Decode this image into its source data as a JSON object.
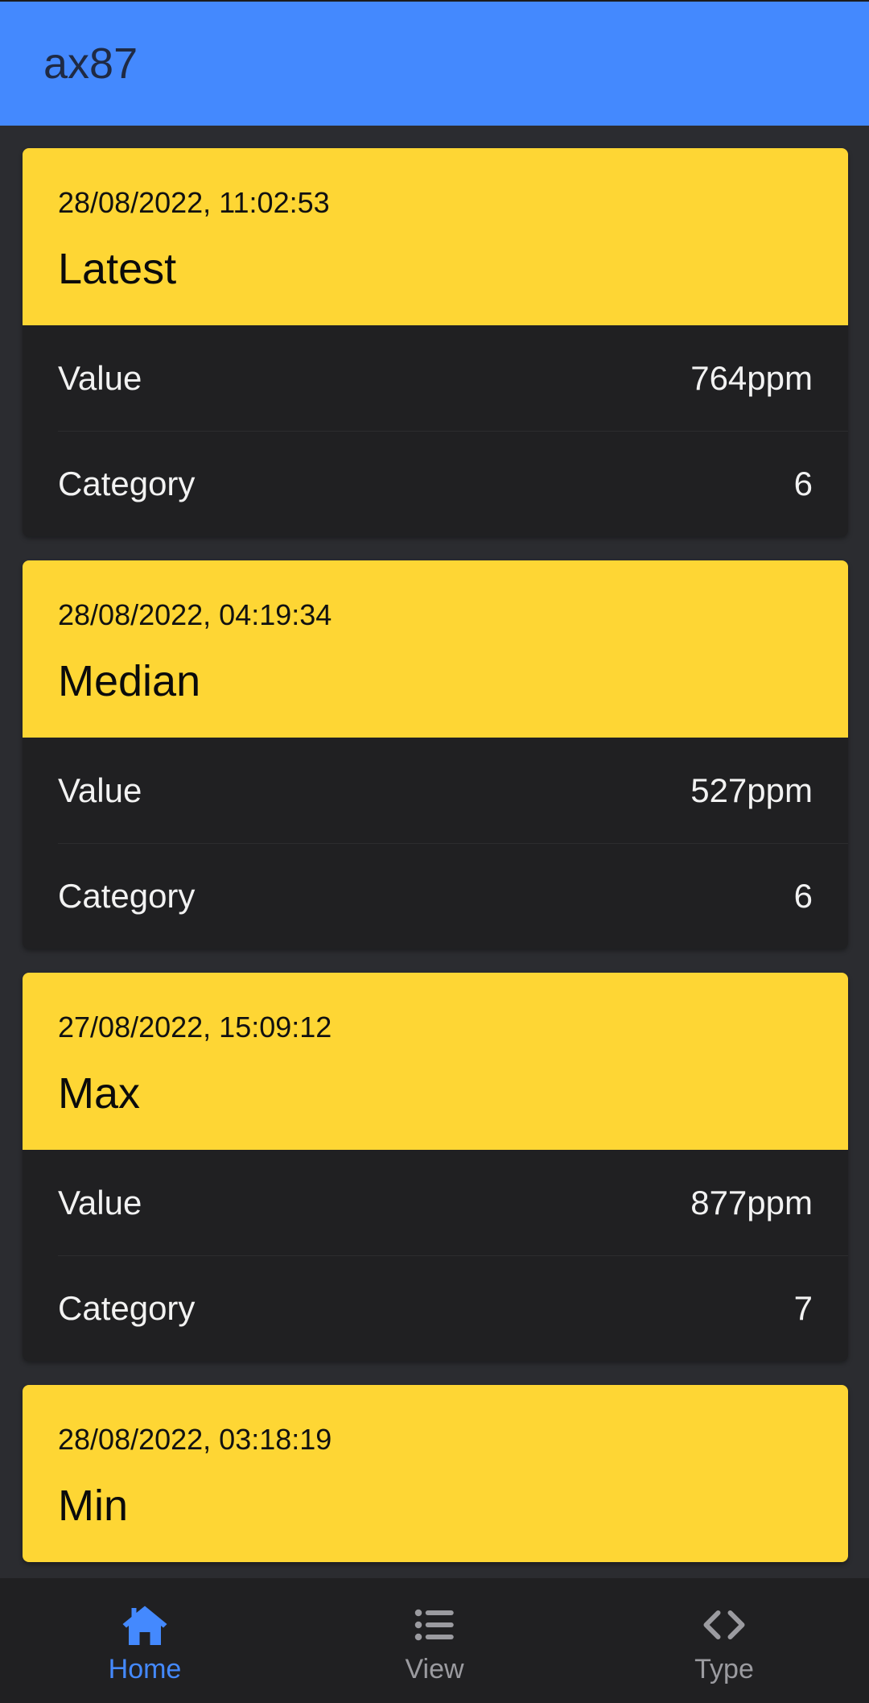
{
  "app": {
    "title": "ax87"
  },
  "cards": [
    {
      "timestamp": "28/08/2022, 11:02:53",
      "title": "Latest",
      "rows": [
        {
          "label": "Value",
          "value": "764ppm"
        },
        {
          "label": "Category",
          "value": "6"
        }
      ]
    },
    {
      "timestamp": "28/08/2022, 04:19:34",
      "title": "Median",
      "rows": [
        {
          "label": "Value",
          "value": "527ppm"
        },
        {
          "label": "Category",
          "value": "6"
        }
      ]
    },
    {
      "timestamp": "27/08/2022, 15:09:12",
      "title": "Max",
      "rows": [
        {
          "label": "Value",
          "value": "877ppm"
        },
        {
          "label": "Category",
          "value": "7"
        }
      ]
    },
    {
      "timestamp": "28/08/2022, 03:18:19",
      "title": "Min"
    }
  ],
  "nav": {
    "items": [
      {
        "label": "Home",
        "icon": "home-icon",
        "active": true
      },
      {
        "label": "View",
        "icon": "list-icon",
        "active": false
      },
      {
        "label": "Type",
        "icon": "code-icon",
        "active": false
      }
    ]
  },
  "colors": {
    "header": "#4489fe",
    "card_header": "#fed634",
    "card_body": "#202022",
    "background": "#2b2c30",
    "nav_active": "#4489fe",
    "nav_inactive": "#9b9ba0"
  }
}
